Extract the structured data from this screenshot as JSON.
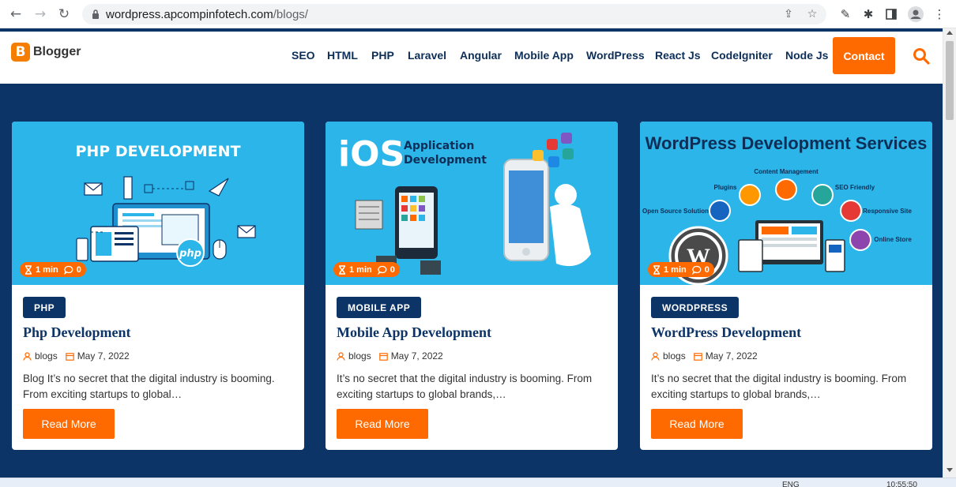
{
  "browser": {
    "url_host": "wordpress.apcompinfotech.com",
    "url_path": "/blogs/"
  },
  "site": {
    "logo_letter": "B",
    "logo_text": "Blogger",
    "menu": [
      "SEO",
      "HTML",
      "PHP",
      "Laravel",
      "Angular",
      "Mobile App",
      "WordPress",
      "React Js",
      "CodeIgniter",
      "Node Js"
    ],
    "contact_label": "Contact"
  },
  "posts": [
    {
      "thumb_heading": "PHP DEVELOPMENT",
      "thumb_logo": "php",
      "read_time": "1 min",
      "comments": "0",
      "category": "PHP",
      "title": "Php Development",
      "author": "blogs",
      "date": "May 7, 2022",
      "excerpt": "Blog It’s no secret that the digital industry is booming. From exciting startups to global…",
      "read_more": "Read More"
    },
    {
      "thumb_heading_big": "iOS",
      "thumb_heading_small_1": "Application",
      "thumb_heading_small_2": "Development",
      "read_time": "1 min",
      "comments": "0",
      "category": "MOBILE APP",
      "title": "Mobile App Development",
      "author": "blogs",
      "date": "May 7, 2022",
      "excerpt": "It’s no secret that the digital industry is booming. From exciting startups to global brands,…",
      "read_more": "Read More"
    },
    {
      "thumb_heading": "WordPress Development Services",
      "thumb_labels": [
        "Content Management",
        "Plugins",
        "SEO Friendly",
        "Open Source Solution",
        "Responsive Site",
        "Online Store"
      ],
      "read_time": "1 min",
      "comments": "0",
      "category": "WORDPRESS",
      "title": "WordPress Development",
      "author": "blogs",
      "date": "May 7, 2022",
      "excerpt": "It’s no secret that the digital industry is booming. From exciting startups to global brands,…",
      "read_more": "Read More"
    }
  ],
  "taskbar": {
    "lang": "ENG",
    "time": "10:55:50"
  },
  "colors": {
    "navy": "#0d3466",
    "orange": "#ff6a00",
    "thumb_blue": "#2cb5e8"
  }
}
